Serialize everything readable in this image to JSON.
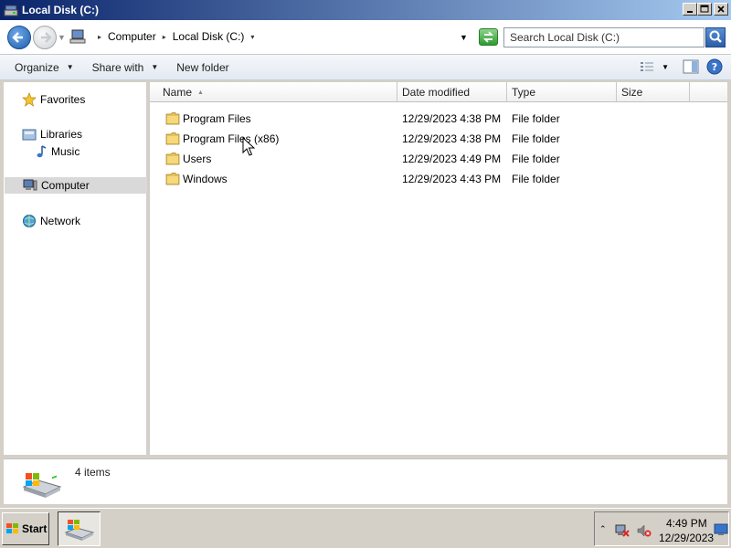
{
  "window": {
    "title": "Local Disk (C:)"
  },
  "address": {
    "crumbs": [
      "Computer",
      "Local Disk (C:)"
    ],
    "search_placeholder": "Search Local Disk (C:)"
  },
  "toolbar": {
    "organize": "Organize",
    "share_with": "Share with",
    "new_folder": "New folder"
  },
  "nav": {
    "favorites": "Favorites",
    "libraries": "Libraries",
    "music": "Music",
    "computer": "Computer",
    "network": "Network"
  },
  "columns": {
    "name": "Name",
    "date_modified": "Date modified",
    "type": "Type",
    "size": "Size"
  },
  "files": [
    {
      "name": "Program Files",
      "date": "12/29/2023 4:38 PM",
      "type": "File folder"
    },
    {
      "name": "Program Files (x86)",
      "date": "12/29/2023 4:38 PM",
      "type": "File folder"
    },
    {
      "name": "Users",
      "date": "12/29/2023 4:49 PM",
      "type": "File folder"
    },
    {
      "name": "Windows",
      "date": "12/29/2023 4:43 PM",
      "type": "File folder"
    }
  ],
  "status": {
    "item_count": "4 items"
  },
  "taskbar": {
    "start_label": "Start",
    "clock_time": "4:49 PM",
    "clock_date": "12/29/2023"
  },
  "colors": {
    "titlebar_start": "#0a246a",
    "titlebar_end": "#a6caf0",
    "selection_gray": "#d9d9d9",
    "folder_yellow": "#e8c25a"
  },
  "icons": {
    "back": "back-arrow-icon",
    "forward": "forward-arrow-icon",
    "refresh": "refresh-icon",
    "search": "search-icon",
    "folder": "folder-icon",
    "drive": "drive-icon"
  }
}
